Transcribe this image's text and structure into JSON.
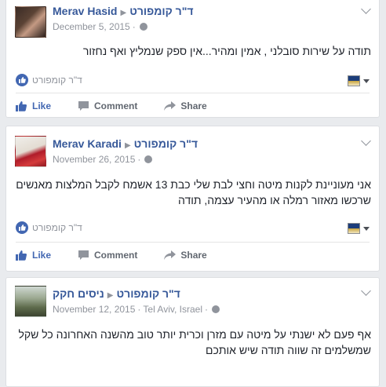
{
  "page_name": "ד\"ר קומפורט",
  "posts": [
    {
      "author": "Merav Hasid",
      "date": "December 5, 2015",
      "location": "",
      "text": "תודה על שירות סובלני , אמין ומהיר...אין ספק שנמליץ ואף נחזור",
      "reaction_label": "ד\"ר קומפורט"
    },
    {
      "author": "Merav Karadi",
      "date": "November 26, 2015",
      "location": "",
      "text": "אני מעוניינת לקנות מיטה וחצי לבת שלי כבת 13 אשמח לקבל המלצות מאנשים שרכשו מאזור רמלה או מהעיר עצמה, תודה",
      "reaction_label": "ד\"ר קומפורט"
    },
    {
      "author": "ניסים חקק",
      "date": "November 12, 2015",
      "location": "Tel Aviv, Israel",
      "text": "אף פעם לא ישנתי על מיטה עם מזרן וכרית יותר טוב מהשנה האחרונה כל שקל שמשלמים זה שווה תודה שיש אותכם",
      "reaction_label": ""
    }
  ],
  "actions": {
    "like": "Like",
    "comment": "Comment",
    "share": "Share"
  },
  "colors": {
    "link": "#365899",
    "like_blue": "#4267b2",
    "meta_gray": "#90949c",
    "background": "#e9ebee"
  },
  "icons": {
    "privacy": "globe-icon",
    "menu": "chevron-down-icon",
    "like": "thumbs-up-icon",
    "comment": "speech-bubble-icon",
    "share": "share-arrow-icon",
    "page_identity": "flag-icon"
  }
}
